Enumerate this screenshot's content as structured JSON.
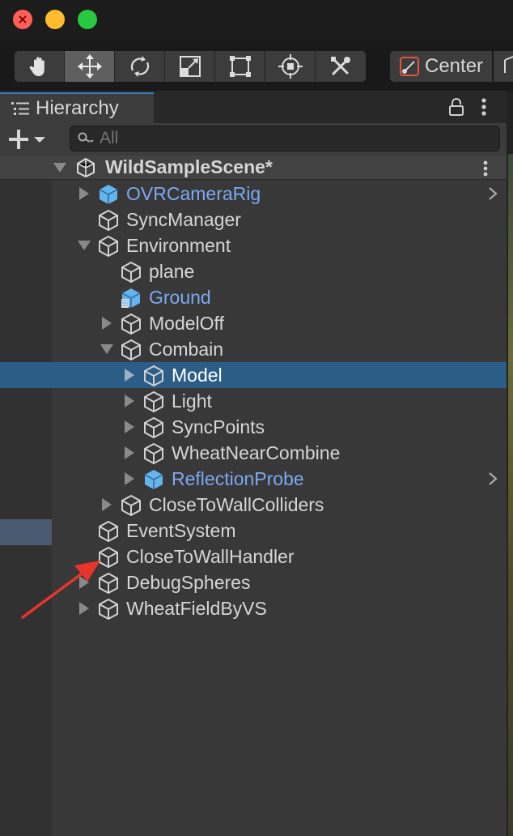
{
  "window": {
    "traffic_lights": [
      "close",
      "minimize",
      "zoom"
    ]
  },
  "toolbar": {
    "tools": [
      {
        "name": "hand-tool",
        "icon": "hand-icon",
        "active": false
      },
      {
        "name": "move-tool",
        "icon": "move-arrows-icon",
        "active": true
      },
      {
        "name": "rotate-tool",
        "icon": "rotate-icon",
        "active": false
      },
      {
        "name": "scale-tool",
        "icon": "scale-icon",
        "active": false
      },
      {
        "name": "rect-tool",
        "icon": "rect-transform-icon",
        "active": false
      },
      {
        "name": "transform-tool",
        "icon": "transform-icon",
        "active": false
      },
      {
        "name": "custom-tool",
        "icon": "tools-icon",
        "active": false
      }
    ],
    "pivot_label": "Center"
  },
  "hierarchy": {
    "tab_label": "Hierarchy",
    "search_placeholder": "All",
    "scene_name": "WildSampleScene*",
    "items": [
      {
        "label": "OVRCameraRig",
        "depth": 0,
        "expand": "collapsed",
        "prefab": true,
        "chevron": true
      },
      {
        "label": "SyncManager",
        "depth": 0,
        "expand": "none",
        "prefab": false
      },
      {
        "label": "Environment",
        "depth": 0,
        "expand": "expanded",
        "prefab": false
      },
      {
        "label": "plane",
        "depth": 1,
        "expand": "none",
        "prefab": false
      },
      {
        "label": "Ground",
        "depth": 1,
        "expand": "none",
        "prefab": true,
        "variant": true
      },
      {
        "label": "ModelOff",
        "depth": 1,
        "expand": "collapsed",
        "prefab": false
      },
      {
        "label": "Combain",
        "depth": 1,
        "expand": "expanded",
        "prefab": false
      },
      {
        "label": "Model",
        "depth": 2,
        "expand": "collapsed",
        "prefab": false,
        "selected": true
      },
      {
        "label": "Light",
        "depth": 2,
        "expand": "collapsed",
        "prefab": false
      },
      {
        "label": "SyncPoints",
        "depth": 2,
        "expand": "collapsed",
        "prefab": false
      },
      {
        "label": "WheatNearCombine",
        "depth": 2,
        "expand": "collapsed",
        "prefab": false
      },
      {
        "label": "ReflectionProbe",
        "depth": 2,
        "expand": "collapsed",
        "prefab": true,
        "chevron": true
      },
      {
        "label": "CloseToWallColliders",
        "depth": 1,
        "expand": "collapsed",
        "prefab": false
      },
      {
        "label": "EventSystem",
        "depth": 0,
        "expand": "none",
        "prefab": false
      },
      {
        "label": "CloseToWallHandler",
        "depth": 0,
        "expand": "none",
        "prefab": false
      },
      {
        "label": "DebugSpheres",
        "depth": 0,
        "expand": "collapsed",
        "prefab": false
      },
      {
        "label": "WheatFieldByVS",
        "depth": 0,
        "expand": "collapsed",
        "prefab": false
      }
    ]
  },
  "colors": {
    "prefab_text": "#7ba9f2",
    "selection": "#2c5d87",
    "annotation_arrow": "#e8352b"
  }
}
